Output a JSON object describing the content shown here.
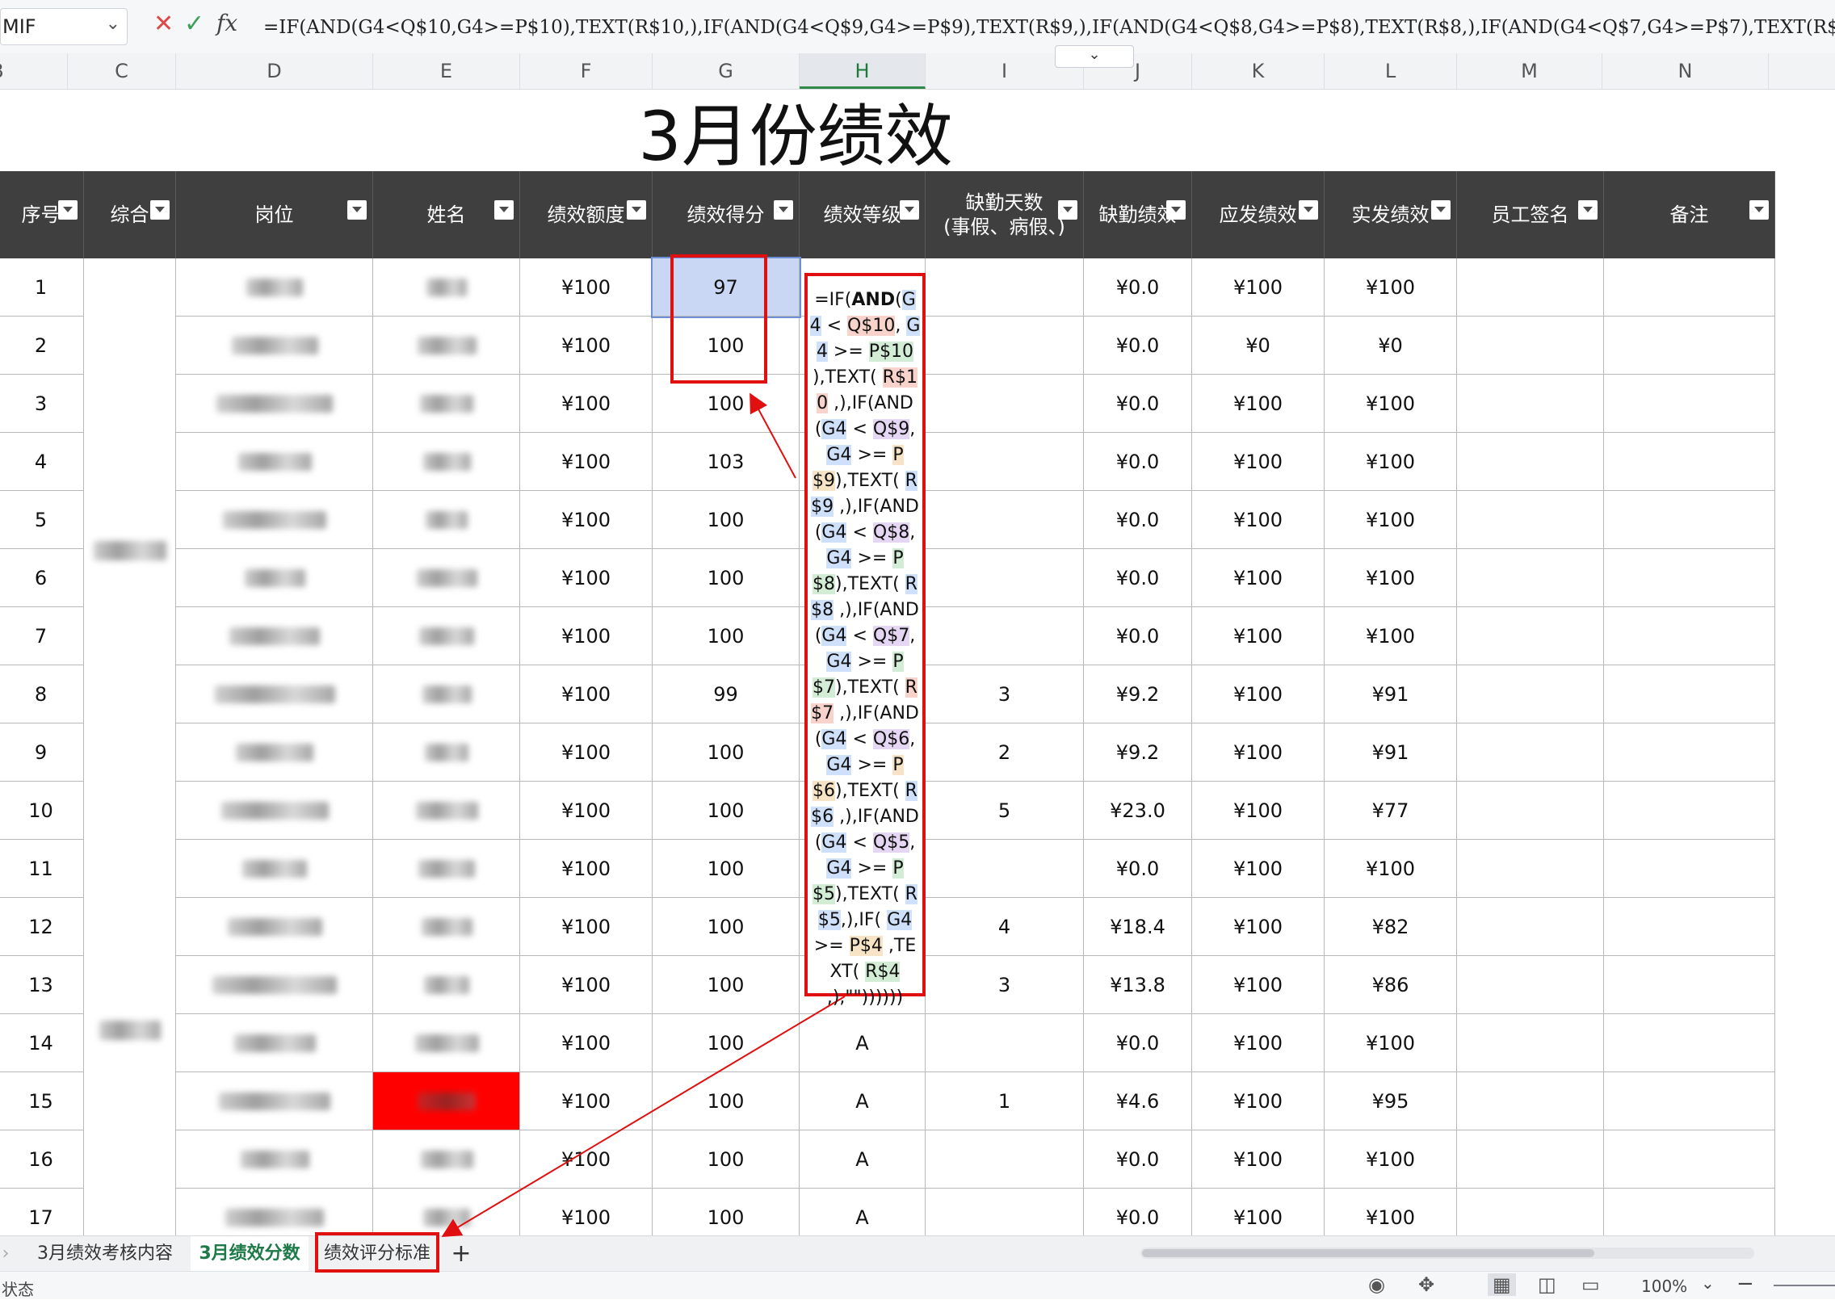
{
  "formula_bar": {
    "name_box": "MIF",
    "formula": "=IF(AND(G4<Q$10,G4>=P$10),TEXT(R$10,),IF(AND(G4<Q$9,G4>=P$9),TEXT(R$9,),IF(AND(G4<Q$8,G4>=P$8),TEXT(R$8,),IF(AND(G4<Q$7,G4>=P$7),TEXT(R$7,),IF(AND(G4"
  },
  "columns": [
    "B",
    "C",
    "D",
    "E",
    "F",
    "G",
    "H",
    "I",
    "J",
    "K",
    "L",
    "M",
    "N"
  ],
  "title": "3月份绩效",
  "headers": [
    "序号",
    "综合",
    "岗位",
    "姓名",
    "绩效额度",
    "绩效得分",
    "绩效等级",
    "缺勤天数\n(事假、病假、)",
    "缺勤绩效",
    "应发绩效",
    "实发绩效",
    "员工签名",
    "备注"
  ],
  "rows": [
    {
      "no": "1",
      "quota": "¥100",
      "score": "97",
      "grade": "",
      "absent": "",
      "absent_pay": "¥0.0",
      "due": "¥100",
      "actual": "¥100"
    },
    {
      "no": "2",
      "quota": "¥100",
      "score": "100",
      "grade": "",
      "absent": "",
      "absent_pay": "¥0.0",
      "due": "¥0",
      "actual": "¥0"
    },
    {
      "no": "3",
      "quota": "¥100",
      "score": "100",
      "grade": "",
      "absent": "",
      "absent_pay": "¥0.0",
      "due": "¥100",
      "actual": "¥100"
    },
    {
      "no": "4",
      "quota": "¥100",
      "score": "103",
      "grade": "",
      "absent": "",
      "absent_pay": "¥0.0",
      "due": "¥100",
      "actual": "¥100"
    },
    {
      "no": "5",
      "quota": "¥100",
      "score": "100",
      "grade": "",
      "absent": "",
      "absent_pay": "¥0.0",
      "due": "¥100",
      "actual": "¥100"
    },
    {
      "no": "6",
      "quota": "¥100",
      "score": "100",
      "grade": "",
      "absent": "",
      "absent_pay": "¥0.0",
      "due": "¥100",
      "actual": "¥100"
    },
    {
      "no": "7",
      "quota": "¥100",
      "score": "100",
      "grade": "",
      "absent": "",
      "absent_pay": "¥0.0",
      "due": "¥100",
      "actual": "¥100"
    },
    {
      "no": "8",
      "quota": "¥100",
      "score": "99",
      "grade": "",
      "absent": "3",
      "absent_pay": "¥9.2",
      "due": "¥100",
      "actual": "¥91"
    },
    {
      "no": "9",
      "quota": "¥100",
      "score": "100",
      "grade": "",
      "absent": "2",
      "absent_pay": "¥9.2",
      "due": "¥100",
      "actual": "¥91"
    },
    {
      "no": "10",
      "quota": "¥100",
      "score": "100",
      "grade": "",
      "absent": "5",
      "absent_pay": "¥23.0",
      "due": "¥100",
      "actual": "¥77"
    },
    {
      "no": "11",
      "quota": "¥100",
      "score": "100",
      "grade": "",
      "absent": "",
      "absent_pay": "¥0.0",
      "due": "¥100",
      "actual": "¥100"
    },
    {
      "no": "12",
      "quota": "¥100",
      "score": "100",
      "grade": "",
      "absent": "4",
      "absent_pay": "¥18.4",
      "due": "¥100",
      "actual": "¥82"
    },
    {
      "no": "13",
      "quota": "¥100",
      "score": "100",
      "grade": "",
      "absent": "3",
      "absent_pay": "¥13.8",
      "due": "¥100",
      "actual": "¥86"
    },
    {
      "no": "14",
      "quota": "¥100",
      "score": "100",
      "grade": "A",
      "absent": "",
      "absent_pay": "¥0.0",
      "due": "¥100",
      "actual": "¥100"
    },
    {
      "no": "15",
      "quota": "¥100",
      "score": "100",
      "grade": "A",
      "absent": "1",
      "absent_pay": "¥4.6",
      "due": "¥100",
      "actual": "¥95"
    },
    {
      "no": "16",
      "quota": "¥100",
      "score": "100",
      "grade": "A",
      "absent": "",
      "absent_pay": "¥0.0",
      "due": "¥100",
      "actual": "¥100"
    },
    {
      "no": "17",
      "quota": "¥100",
      "score": "100",
      "grade": "A",
      "absent": "",
      "absent_pay": "¥0.0",
      "due": "¥100",
      "actual": "¥100"
    }
  ],
  "tabs": [
    "3月绩效考核内容",
    "3月绩效分数",
    "绩效评分标准"
  ],
  "status": {
    "left": "状态",
    "zoom": "100%"
  },
  "colors": {
    "header_bg": "#3f3f3f",
    "annotation": "#e01010",
    "highlight_name": "#ff0000"
  }
}
